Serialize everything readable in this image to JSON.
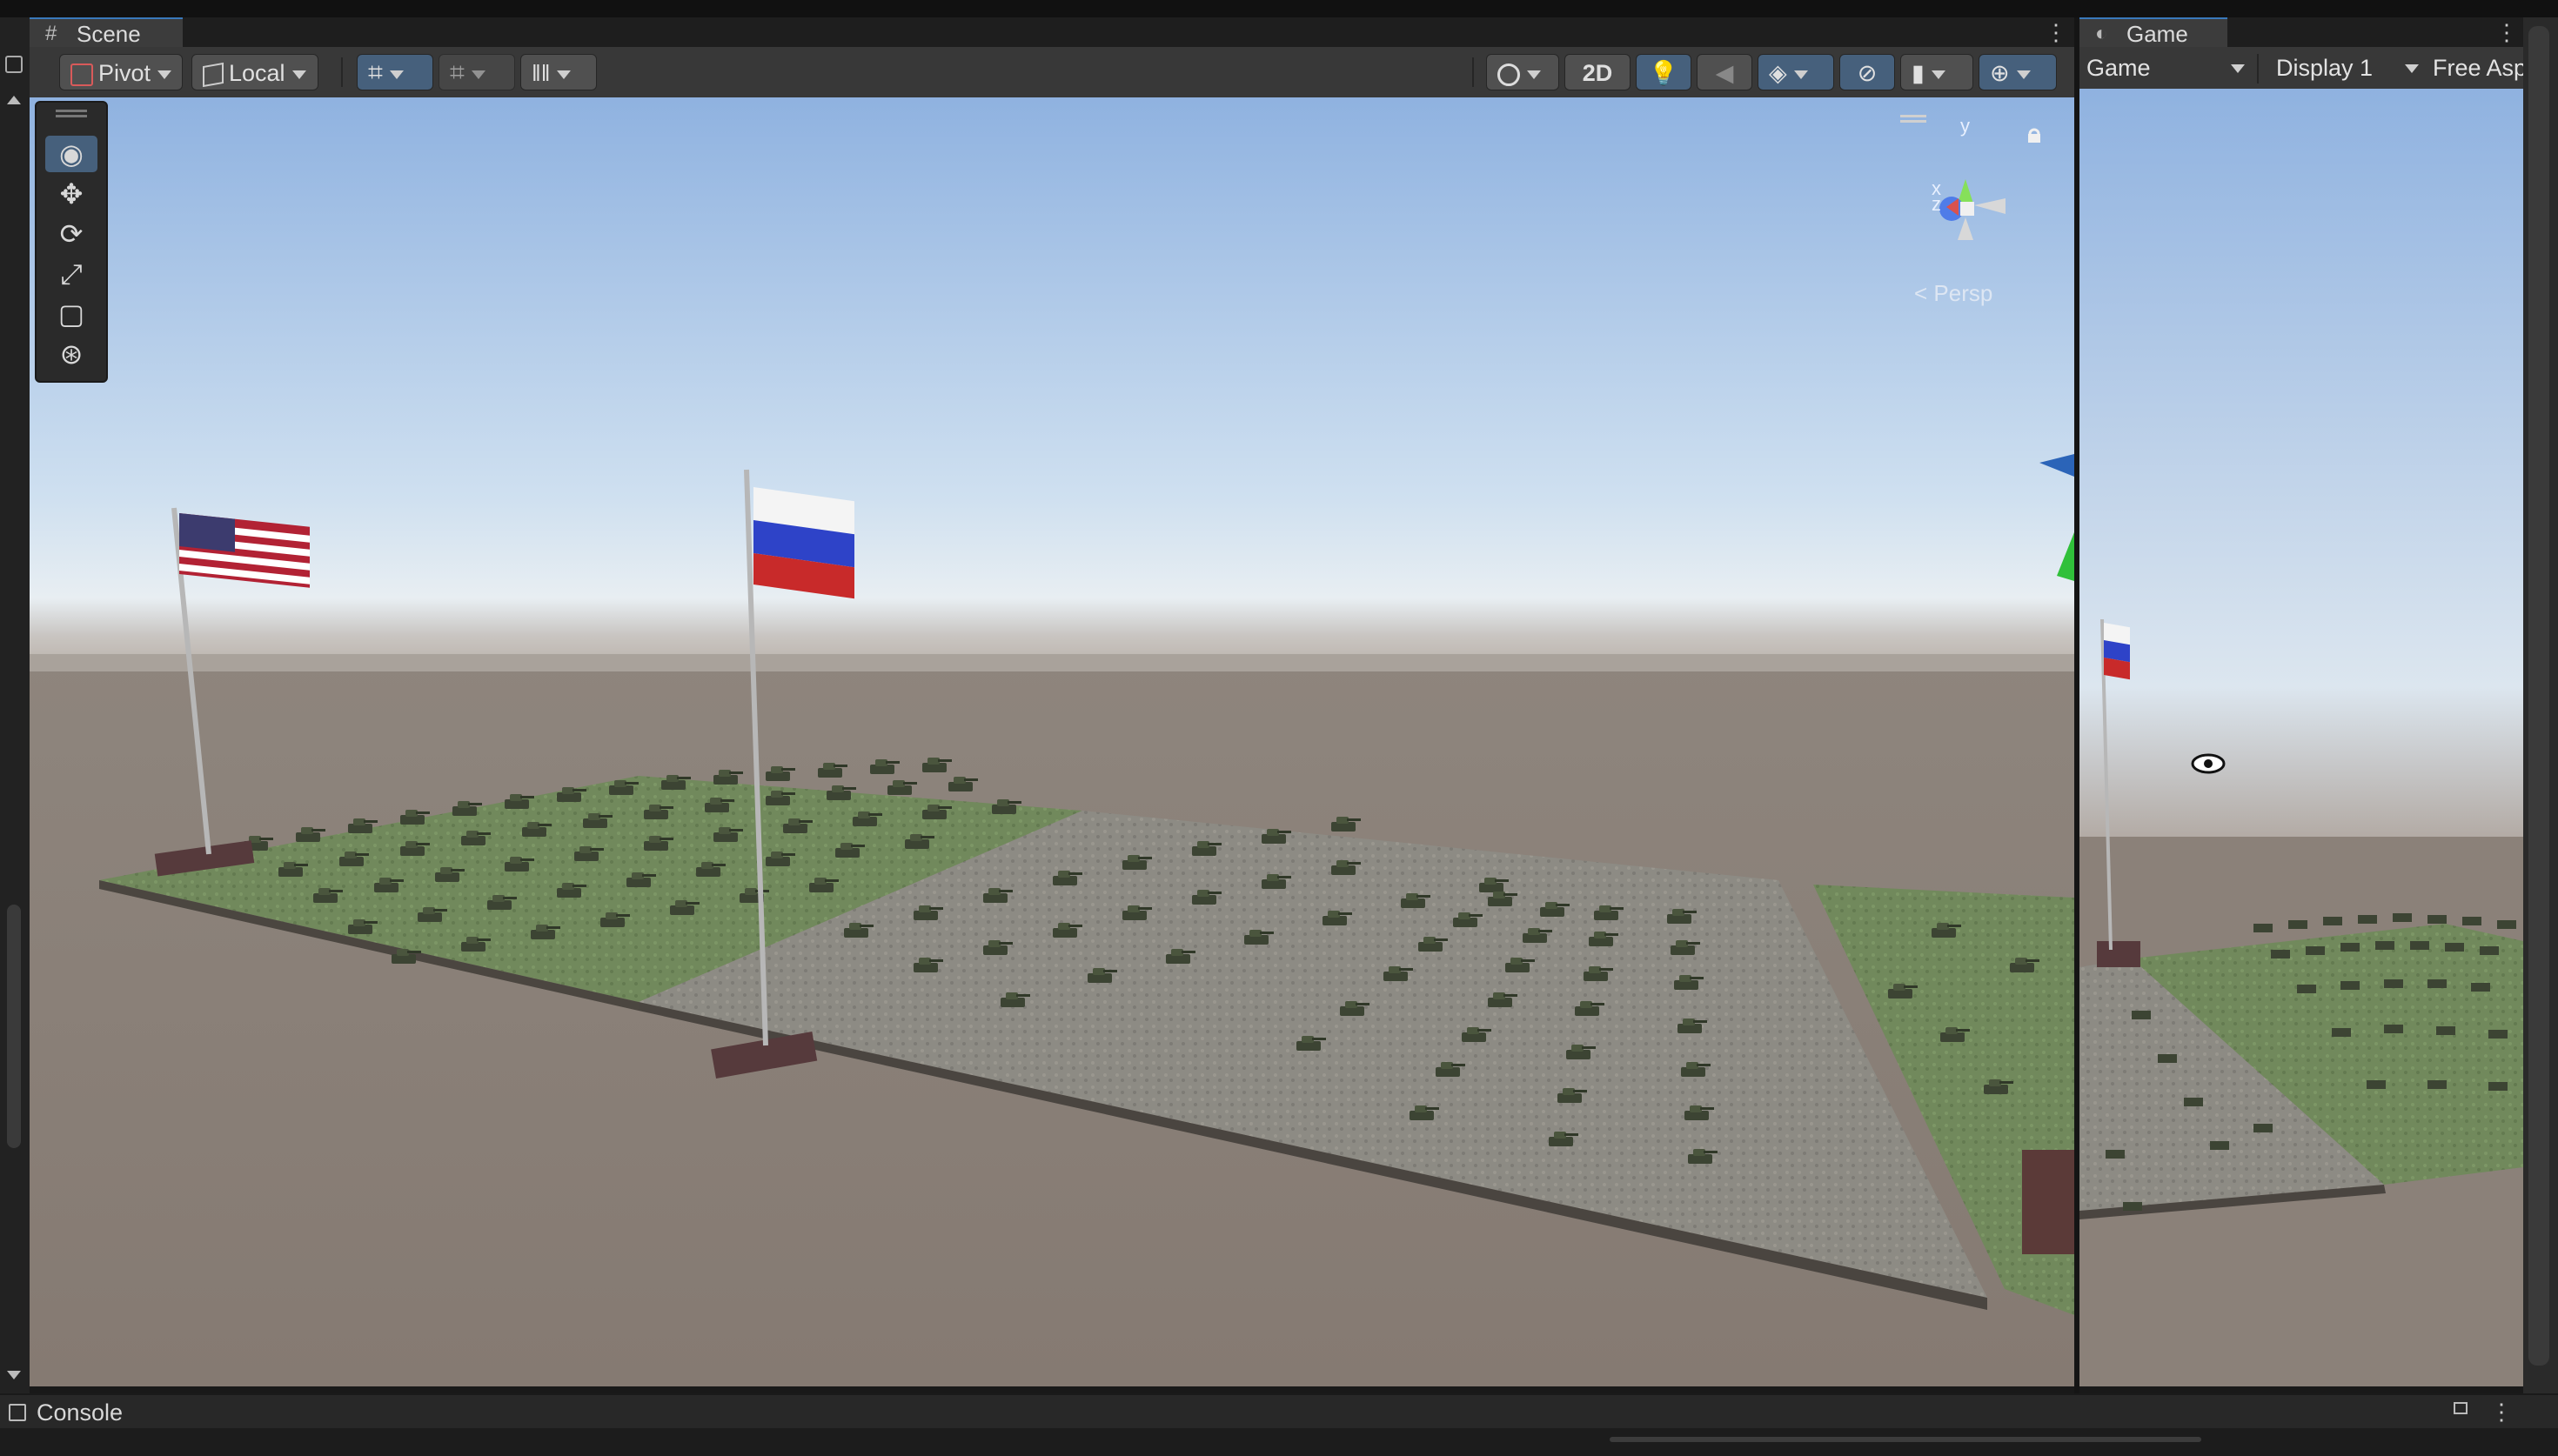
{
  "scene_panel": {
    "tab_label": "Scene",
    "toolbar": {
      "pivot_label": "Pivot",
      "local_label": "Local",
      "mode_2d_label": "2D"
    },
    "tools": [
      "view-tool",
      "move-tool",
      "rotate-tool",
      "scale-tool",
      "rect-tool",
      "transform-tool"
    ],
    "gizmo": {
      "axis_y": "y",
      "axis_x": "x",
      "axis_z": "z",
      "projection_label": "< Persp"
    }
  },
  "game_panel": {
    "tab_label": "Game",
    "view_mode_label": "Game",
    "display_label": "Display 1",
    "aspect_label": "Free Asp"
  },
  "console": {
    "label": "Console"
  },
  "colors": {
    "accent_selected": "#46607c",
    "panel_bg": "#383838",
    "sky_top": "#8fb2e0",
    "ground": "#8a7f77",
    "grass_tile": "#6f8a58",
    "stone_tile": "#8c8a82"
  },
  "icons": {
    "scene_tab": "grid-icon",
    "game_tab": "gamepad-icon",
    "console_tab": "list-icon",
    "lock": "lock-icon"
  }
}
